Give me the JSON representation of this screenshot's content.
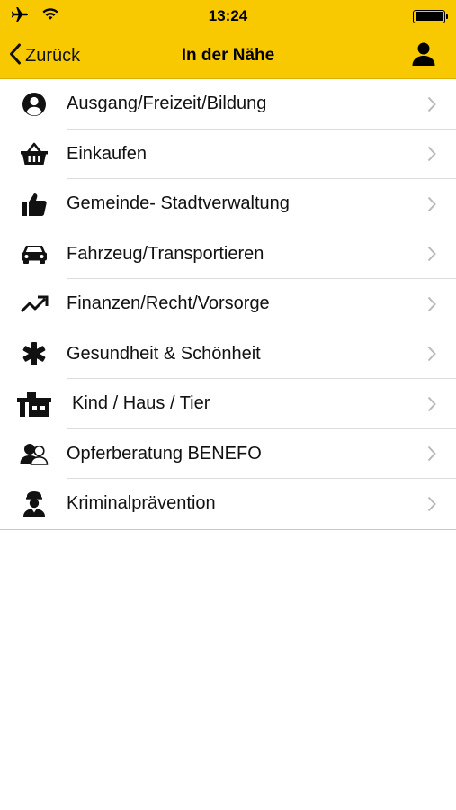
{
  "status_bar": {
    "time": "13:24",
    "icons": [
      "airplane-icon",
      "wifi-icon",
      "battery-icon"
    ]
  },
  "nav": {
    "back_label": "Zurück",
    "title": "In der Nähe",
    "profile_icon": "person-icon"
  },
  "colors": {
    "accent": "#f9c900",
    "separator": "#dcdcdf",
    "chevron": "#b9b9bd"
  },
  "list": {
    "items": [
      {
        "label": "Ausgang/Freizeit/Bildung",
        "icon": "user-circle-icon"
      },
      {
        "label": "Einkaufen",
        "icon": "basket-icon"
      },
      {
        "label": "Gemeinde- Stadtverwaltung",
        "icon": "thumbs-up-icon"
      },
      {
        "label": "Fahrzeug/Transportieren",
        "icon": "car-icon"
      },
      {
        "label": "Finanzen/Recht/Vorsorge",
        "icon": "trending-up-icon"
      },
      {
        "label": "Gesundheit & Schönheit",
        "icon": "asterisk-icon"
      },
      {
        "label": "Kind / Haus / Tier",
        "icon": "house-icon"
      },
      {
        "label": "Opferberatung BENEFO",
        "icon": "people-icon"
      },
      {
        "label": "Kriminalprävention",
        "icon": "police-officer-icon"
      }
    ]
  }
}
